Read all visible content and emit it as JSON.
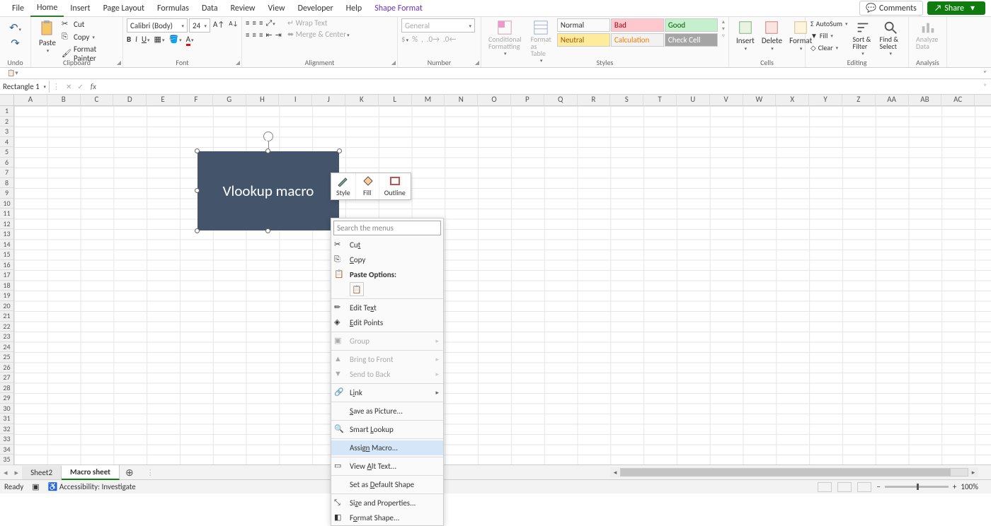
{
  "menu": {
    "items": [
      "File",
      "Home",
      "Insert",
      "Page Layout",
      "Formulas",
      "Data",
      "Review",
      "View",
      "Developer",
      "Help",
      "Shape Format"
    ],
    "active": 1,
    "comments": "Comments",
    "share": "Share"
  },
  "ribbon": {
    "undo_label": "Undo",
    "paste": "Paste",
    "cut": "Cut",
    "copy": "Copy",
    "format_painter": "Format Painter",
    "clipboard_label": "Clipboard",
    "font_name": "Calibri (Body)",
    "font_size": "24",
    "font_label": "Font",
    "wrap": "Wrap Text",
    "merge": "Merge & Center",
    "align_label": "Alignment",
    "num_combo": "General",
    "num_label": "Number",
    "cond_fmt": "Conditional Formatting",
    "fmt_table": "Format as Table",
    "styles": [
      "Normal",
      "Bad",
      "Good",
      "Neutral",
      "Calculation",
      "Check Cell"
    ],
    "styles_label": "Styles",
    "insert": "Insert",
    "delete": "Delete",
    "format": "Format",
    "cells_label": "Cells",
    "autosum": "AutoSum",
    "fill": "Fill",
    "clear": "Clear",
    "sort": "Sort & Filter",
    "find": "Find & Select",
    "editing_label": "Editing",
    "analyze": "Analyze Data",
    "analysis_label": "Analysis"
  },
  "namebox": "Rectangle 1",
  "cols": [
    "A",
    "B",
    "C",
    "D",
    "E",
    "F",
    "G",
    "H",
    "I",
    "J",
    "K",
    "L",
    "M",
    "N",
    "O",
    "P",
    "Q",
    "R",
    "S",
    "T",
    "U",
    "V",
    "W",
    "X",
    "Y",
    "Z",
    "AA",
    "AB",
    "AC"
  ],
  "shape_text": "Vlookup macro",
  "mini": {
    "style": "Style",
    "fill": "Fill",
    "outline": "Outline"
  },
  "ctx": {
    "search_ph": "Search the menus",
    "cut": "Cut",
    "copy": "Copy",
    "paste_options": "Paste Options:",
    "edit_text": "Edit Text",
    "edit_points": "Edit Points",
    "group": "Group",
    "bring_front": "Bring to Front",
    "send_back": "Send to Back",
    "link": "Link",
    "save_pic": "Save as Picture...",
    "smart": "Smart Lookup",
    "assign_macro": "Assign Macro...",
    "alt_text": "View Alt Text...",
    "set_default": "Set as Default Shape",
    "size_prop": "Size and Properties...",
    "format_shape": "Format Shape..."
  },
  "sheets": {
    "tabs": [
      "Sheet2",
      "Macro sheet"
    ],
    "active": 1
  },
  "status": {
    "ready": "Ready",
    "access": "Accessibility: Investigate",
    "zoom": "100%"
  }
}
